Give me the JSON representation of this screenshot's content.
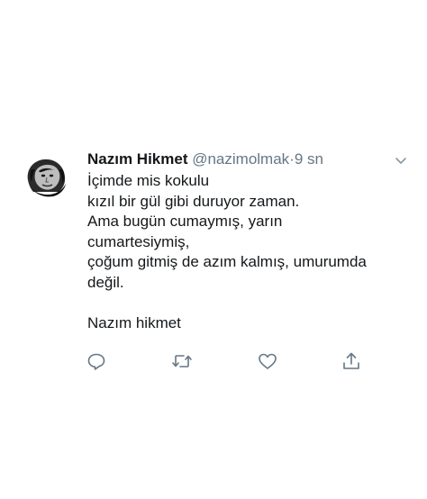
{
  "tweet": {
    "author_name": "Nazım Hikmet",
    "author_handle": "@nazimolmak",
    "separator": "·",
    "time": "9 sn",
    "lines": [
      "İçimde mis kokulu",
      "kızıl bir gül gibi duruyor zaman.",
      "Ama bugün cumaymış, yarın",
      "cumartesiymiş,",
      "çoğum gitmiş de azım kalmış, umurumda",
      "değil.",
      "",
      "Nazım hikmet"
    ]
  },
  "icons": {
    "caret": "chevron-down-icon",
    "reply": "reply-icon",
    "retweet": "retweet-icon",
    "like": "heart-icon",
    "share": "share-icon"
  },
  "colors": {
    "text": "#14171a",
    "secondary": "#657786",
    "icon": "#657786"
  }
}
